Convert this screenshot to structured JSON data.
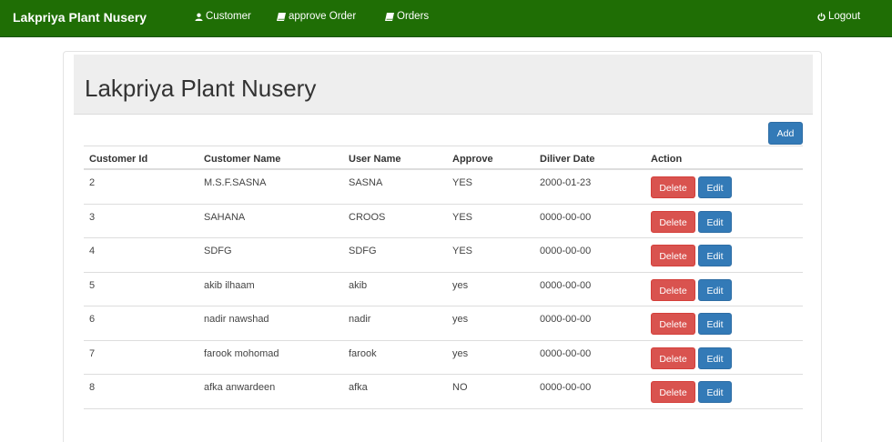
{
  "navbar": {
    "brand": "Lakpriya Plant Nusery",
    "items": [
      {
        "label": "Customer",
        "icon": "user-icon"
      },
      {
        "label": "approve Order",
        "icon": "book-icon"
      },
      {
        "label": "Orders",
        "icon": "book-icon"
      }
    ],
    "logout": {
      "label": "Logout",
      "icon": "power-icon"
    },
    "color": "#1f6e05"
  },
  "main": {
    "title": "Lakpriya Plant Nusery",
    "add_label": "Add",
    "columns": [
      "Customer Id",
      "Customer Name",
      "User Name",
      "Approve",
      "Diliver Date",
      "Action"
    ],
    "rows": [
      {
        "id": "2",
        "name": "M.S.F.SASNA",
        "user": "SASNA",
        "approve": "YES",
        "date": "2000-01-23",
        "delete": "Delete",
        "edit": "Edit"
      },
      {
        "id": "3",
        "name": "SAHANA",
        "user": "CROOS",
        "approve": "YES",
        "date": "0000-00-00",
        "delete": "Delete",
        "edit": "Edit"
      },
      {
        "id": "4",
        "name": "SDFG",
        "user": "SDFG",
        "approve": "YES",
        "date": "0000-00-00",
        "delete": "Delete",
        "edit": "Edit"
      },
      {
        "id": "5",
        "name": "akib ilhaam",
        "user": "akib",
        "approve": "yes",
        "date": "0000-00-00",
        "delete": "Delete",
        "edit": "Edit"
      },
      {
        "id": "6",
        "name": "nadir nawshad",
        "user": "nadir",
        "approve": "yes",
        "date": "0000-00-00",
        "delete": "Delete",
        "edit": "Edit"
      },
      {
        "id": "7",
        "name": "farook mohomad",
        "user": "farook",
        "approve": "yes",
        "date": "0000-00-00",
        "delete": "Delete",
        "edit": "Edit"
      },
      {
        "id": "8",
        "name": "afka anwardeen",
        "user": "afka",
        "approve": "NO",
        "date": "0000-00-00",
        "delete": "Delete",
        "edit": "Edit"
      }
    ],
    "colors": {
      "delete": "#d9534f",
      "primary": "#337ab7"
    }
  }
}
